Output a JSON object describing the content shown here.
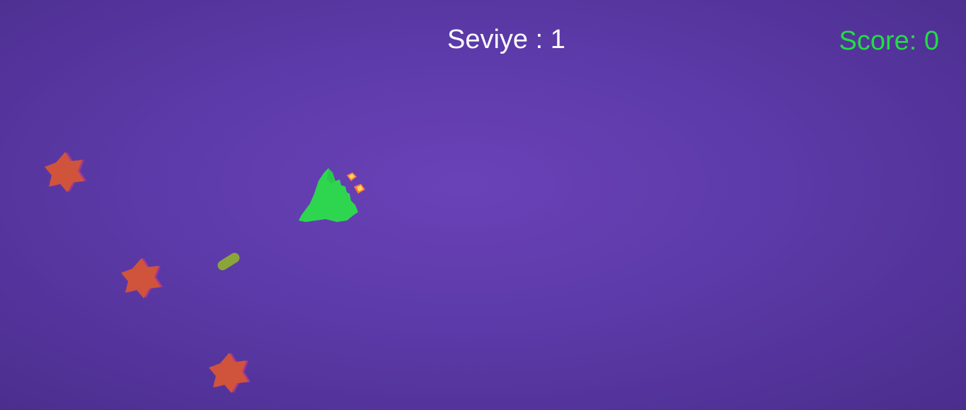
{
  "hud": {
    "level_label": "Seviye",
    "level_separator": ":",
    "level_value": "1",
    "score_label": "Score:",
    "score_value": "0"
  },
  "sprites": {
    "player": "player-ship-green",
    "projectile": "bullet-capsule-olive",
    "enemies": [
      "red-star-asteroid",
      "red-star-asteroid",
      "red-star-asteroid"
    ]
  },
  "colors": {
    "background": "#5f3cac",
    "level_text": "#ffffff",
    "score_text": "#22dd44",
    "ship": "#2ed650",
    "thruster": "#ff8a3c",
    "bullet": "#8aa63a",
    "star": "#d0543c",
    "star_shadow": "#b03a8a"
  }
}
